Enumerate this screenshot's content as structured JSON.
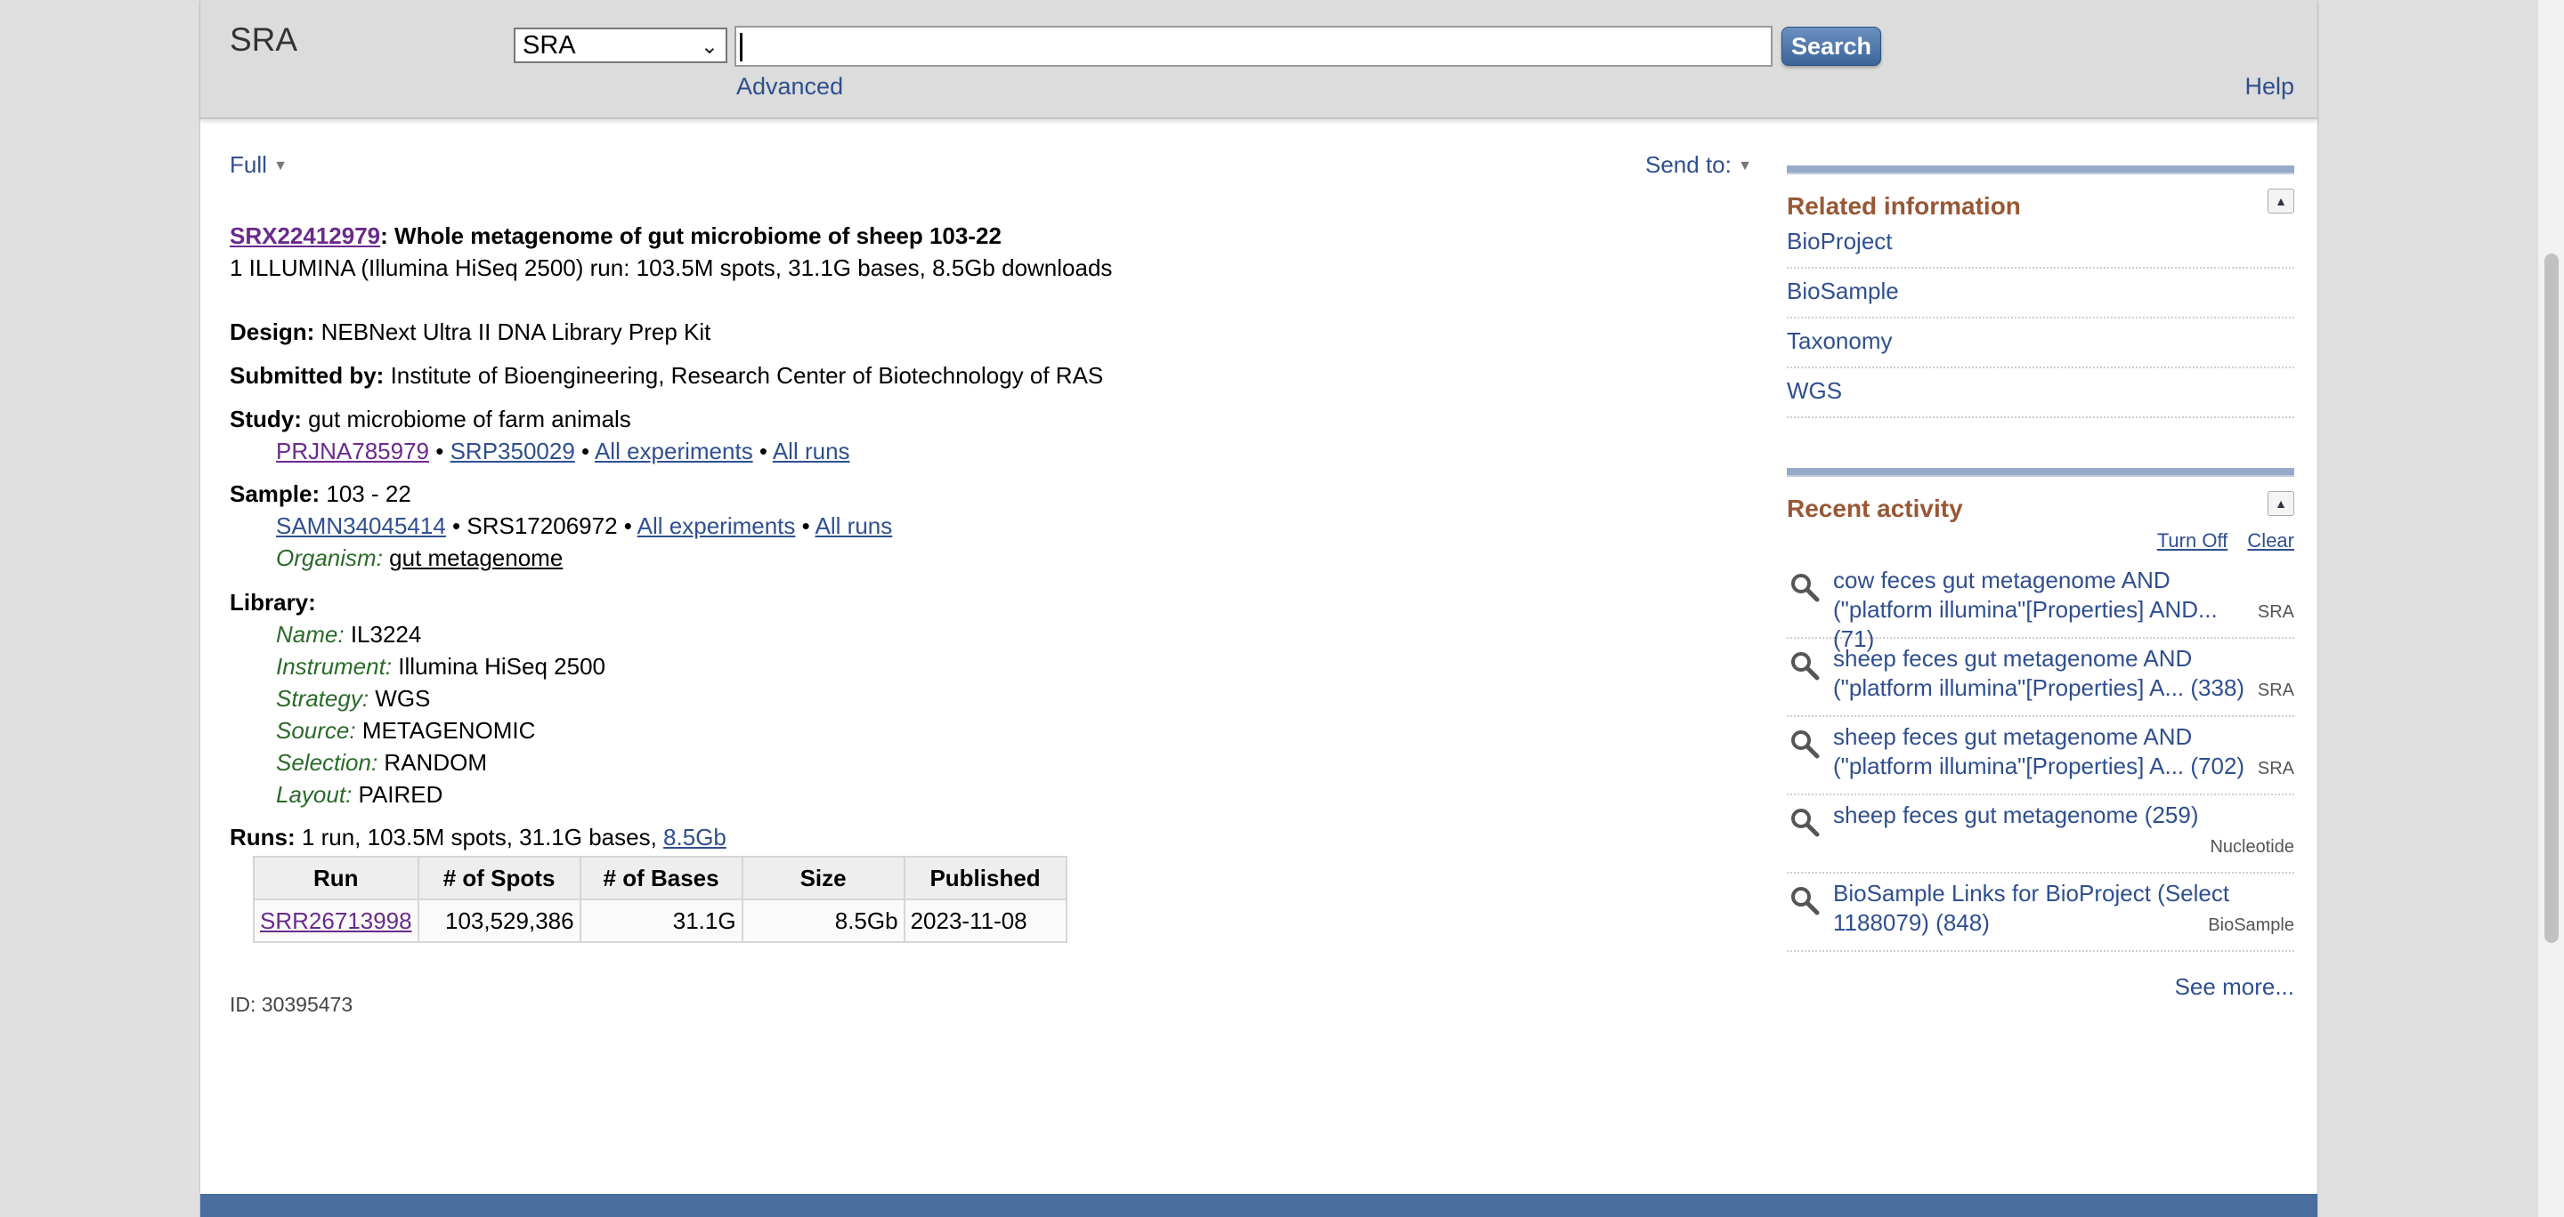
{
  "header": {
    "db_name": "SRA",
    "db_select_value": "SRA",
    "search_value": "",
    "search_button": "Search",
    "advanced_link": "Advanced",
    "help_link": "Help"
  },
  "toolbar": {
    "format": "Full",
    "send_to": "Send to:"
  },
  "record": {
    "accession": "SRX22412979",
    "title": ": Whole metagenome of gut microbiome of sheep 103-22",
    "summary": "1 ILLUMINA (Illumina HiSeq 2500) run: 103.5M spots, 31.1G bases, 8.5Gb downloads",
    "design_label": "Design:",
    "design_value": "NEBNext Ultra II DNA Library Prep Kit",
    "submitted_label": "Submitted by:",
    "submitted_value": "Institute of Bioengineering, Research Center of Biotechnology of RAS",
    "study_label": "Study:",
    "study_value": "gut microbiome of farm animals",
    "study_links": {
      "bioproject": "PRJNA785979",
      "srp": "SRP350029",
      "all_experiments": "All experiments",
      "all_runs": "All runs",
      "sep": "•"
    },
    "sample_label": "Sample:",
    "sample_value": "103 - 22",
    "sample_links": {
      "biosample": "SAMN34045414",
      "srs": "SRS17206972",
      "all_experiments": "All experiments",
      "all_runs": "All runs",
      "sep": "•"
    },
    "organism_label": "Organism:",
    "organism_value": "gut metagenome",
    "library_label": "Library:",
    "library": {
      "name_label": "Name:",
      "name_value": "IL3224",
      "instrument_label": "Instrument:",
      "instrument_value": "Illumina HiSeq 2500",
      "strategy_label": "Strategy:",
      "strategy_value": "WGS",
      "source_label": "Source:",
      "source_value": "METAGENOMIC",
      "selection_label": "Selection:",
      "selection_value": "RANDOM",
      "layout_label": "Layout:",
      "layout_value": "PAIRED"
    },
    "runs_label": "Runs:",
    "runs_value": "1 run, 103.5M spots, 31.1G bases,",
    "runs_download": "8.5Gb",
    "runs_table": {
      "headers": [
        "Run",
        "# of Spots",
        "# of Bases",
        "Size",
        "Published"
      ],
      "rows": [
        [
          "SRR26713998",
          "103,529,386",
          "31.1G",
          "8.5Gb",
          "2023-11-08"
        ]
      ]
    },
    "id_line": "ID: 30395473"
  },
  "sidebar": {
    "related_title": "Related information",
    "related_links": [
      "BioProject",
      "BioSample",
      "Taxonomy",
      "WGS"
    ],
    "recent_title": "Recent activity",
    "turn_off": "Turn Off",
    "clear": "Clear",
    "recent_items": [
      {
        "text": "cow feces gut metagenome AND (\"platform illumina\"[Properties] AND... (71)",
        "db": "SRA"
      },
      {
        "text": "sheep feces gut metagenome AND (\"platform illumina\"[Properties] A... (338)",
        "db": "SRA"
      },
      {
        "text": "sheep feces gut metagenome AND (\"platform illumina\"[Properties] A... (702)",
        "db": "SRA"
      },
      {
        "text": "sheep feces gut metagenome (259)",
        "db": "Nucleotide"
      },
      {
        "text": "BioSample Links for BioProject (Select 1188079) (848)",
        "db": "BioSample"
      }
    ],
    "see_more": "See more..."
  },
  "colors": {
    "link": "#2f4f8f",
    "visited_link": "#6a2a8c",
    "portlet_title": "#985735",
    "attr_label": "#2a6a2a",
    "footer_band": "#4a6e9d"
  }
}
